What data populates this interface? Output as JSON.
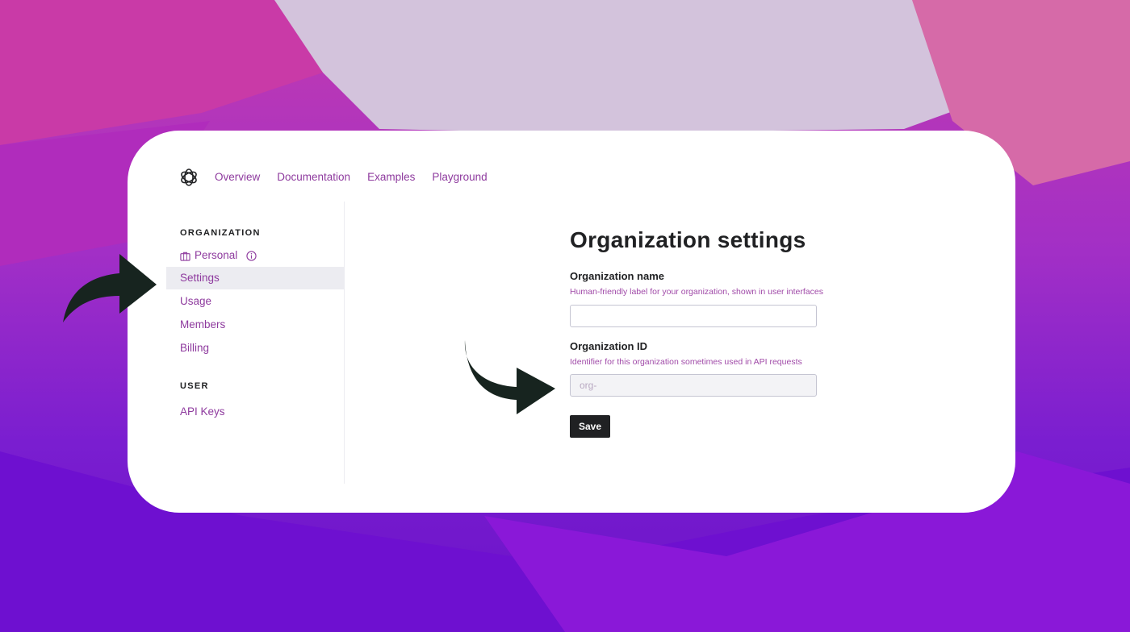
{
  "nav": {
    "items": [
      "Overview",
      "Documentation",
      "Examples",
      "Playground"
    ]
  },
  "sidebar": {
    "organization_title": "ORGANIZATION",
    "personal_label": "Personal",
    "org_items": [
      "Settings",
      "Usage",
      "Members",
      "Billing"
    ],
    "active_item": "Settings",
    "user_title": "USER",
    "user_items": [
      "API Keys"
    ]
  },
  "main": {
    "title": "Organization settings",
    "org_name": {
      "label": "Organization name",
      "help": "Human-friendly label for your organization, shown in user interfaces",
      "value": ""
    },
    "org_id": {
      "label": "Organization ID",
      "help": "Identifier for this organization sometimes used in API requests",
      "value": "org-"
    },
    "save_label": "Save"
  },
  "icons": {
    "logo": "openai-logo-icon",
    "personal": "briefcase-icon",
    "info": "info-icon",
    "arrows": "curved-arrow-icon"
  },
  "colors": {
    "text_dark": "#202123",
    "link_purple": "#8e3a9e",
    "active_bg": "#ececf1",
    "arrow": "#17241f"
  }
}
